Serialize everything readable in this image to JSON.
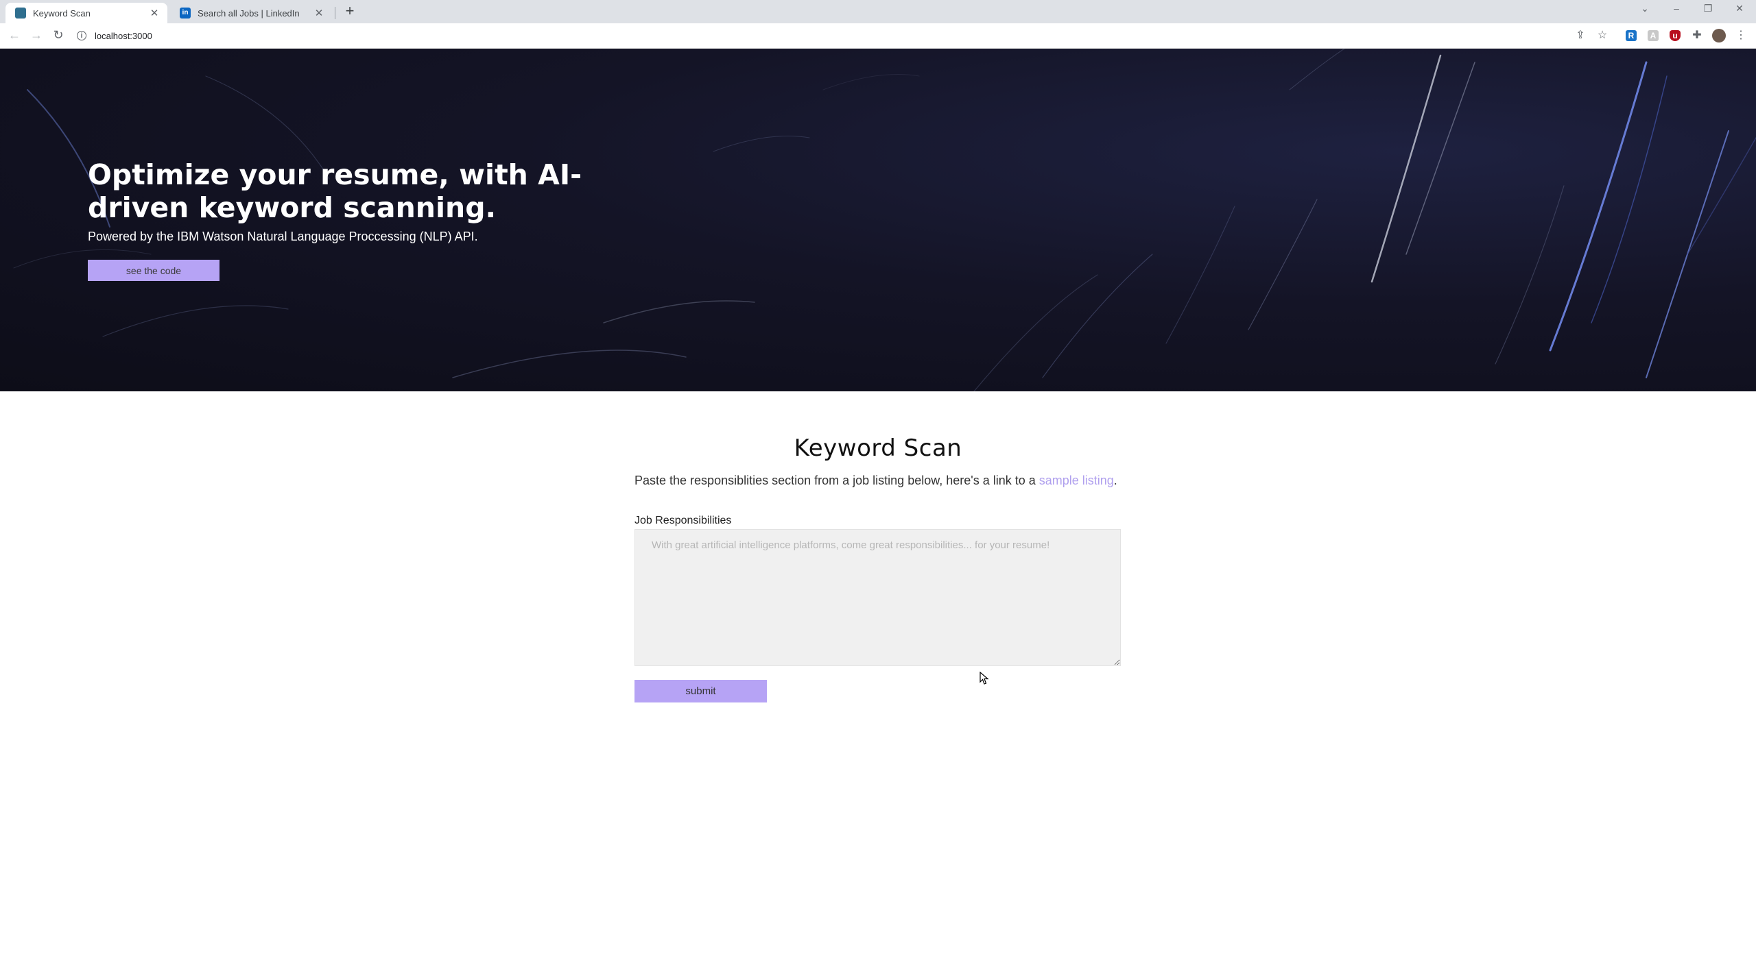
{
  "browser": {
    "tabs": [
      {
        "title": "Keyword Scan",
        "active": true,
        "favicon": "keyword-scan-favicon"
      },
      {
        "title": "Search all Jobs | LinkedIn",
        "active": false,
        "favicon": "linkedin-favicon"
      }
    ],
    "new_tab_symbol": "+",
    "address": "localhost:3000",
    "toolbar_icons": [
      "share-icon",
      "star-icon",
      "extension-r-icon",
      "extension-grey-icon",
      "ublock-icon",
      "puzzle-icon",
      "profile-avatar",
      "menu-icon"
    ]
  },
  "hero": {
    "title": "Optimize your resume, with AI-driven keyword scanning.",
    "subtitle": "Powered by the IBM Watson Natural Language Proccessing (NLP) API.",
    "button_label": "see the code"
  },
  "main": {
    "title": "Keyword Scan",
    "description_prefix": "Paste the responsiblities section from a job listing below, here's a link to a ",
    "description_link": "sample listing",
    "description_suffix": ".",
    "field_label": "Job Responsibilities",
    "textarea_value": "",
    "textarea_placeholder": "With great artificial intelligence platforms, come great responsibilities... for your resume!",
    "submit_label": "submit"
  },
  "colors": {
    "accent": "#b6a3f5",
    "link": "#b0a0ee",
    "hero_bg": "#141426"
  }
}
